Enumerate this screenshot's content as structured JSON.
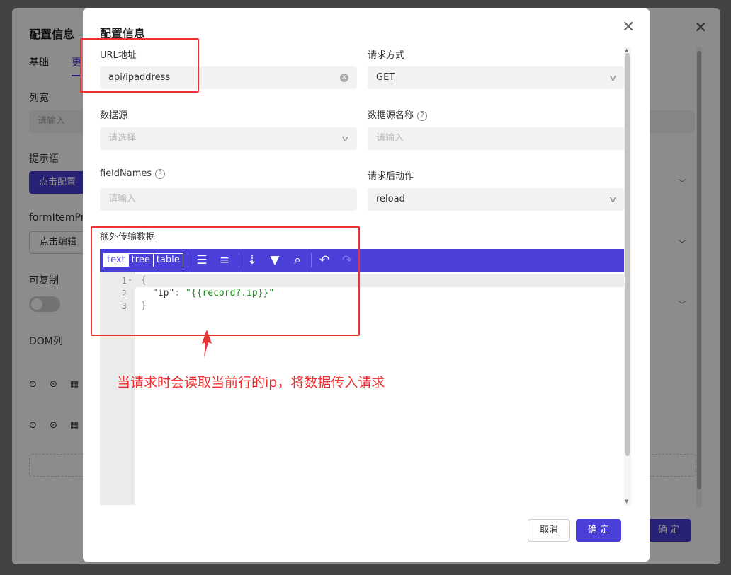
{
  "background": {
    "title": "配置信息",
    "tabs": [
      "基础",
      "更"
    ],
    "labels": {
      "col_width": "列宽",
      "tooltip": "提示语",
      "form_item": "formItemPro",
      "copyable": "可复制",
      "dom_col": "DOM列"
    },
    "col_width_placeholder": "请输入",
    "tooltip_button": "点击配置",
    "form_item_button": "点击编辑",
    "icon_row_text": "⊙ ⊙ ▦ ▯",
    "confirm": "确 定"
  },
  "modal": {
    "title": "配置信息",
    "fields": {
      "url": {
        "label": "URL地址",
        "value": "api/ipaddress"
      },
      "method": {
        "label": "请求方式",
        "value": "GET"
      },
      "datasource": {
        "label": "数据源",
        "placeholder": "请选择"
      },
      "datasource_name": {
        "label": "数据源名称",
        "placeholder": "请输入"
      },
      "field_names": {
        "label": "fieldNames",
        "placeholder": "请输入"
      },
      "after_action": {
        "label": "请求后动作",
        "value": "reload"
      },
      "extra_data": {
        "label": "额外传输数据"
      }
    },
    "editor": {
      "modes": [
        "text",
        "tree",
        "table"
      ],
      "active_mode": "text",
      "line_numbers": [
        "1",
        "2",
        "3"
      ],
      "lines": {
        "open": "{",
        "key": "\"ip\"",
        "colon": ": ",
        "value": "\"{{record?.ip}}\"",
        "close": "}"
      }
    },
    "annotation": "当请求时会读取当前行的ip，将数据传入请求",
    "footer": {
      "cancel": "取消",
      "ok": "确 定"
    }
  },
  "colors": {
    "accent": "#4a3fd9",
    "annotation": "#ee3030"
  }
}
